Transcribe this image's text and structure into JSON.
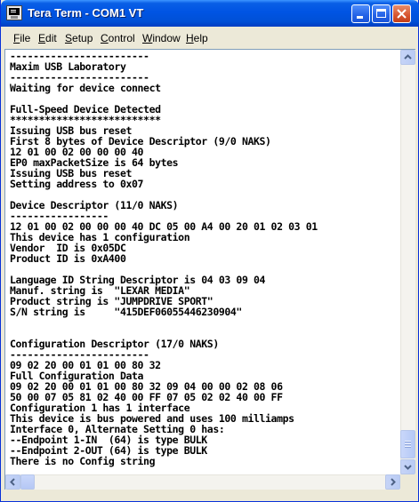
{
  "window": {
    "title": "Tera Term - COM1 VT"
  },
  "menu": [
    {
      "key": "F",
      "rest": "ile"
    },
    {
      "key": "E",
      "rest": "dit"
    },
    {
      "key": "S",
      "rest": "etup"
    },
    {
      "key": "C",
      "rest": "ontrol"
    },
    {
      "key": "W",
      "rest": "indow"
    },
    {
      "key": "H",
      "rest": "elp"
    }
  ],
  "terminal": {
    "lines": [
      "------------------------",
      "Maxim USB Laboratory",
      "------------------------",
      "Waiting for device connect",
      "",
      "Full-Speed Device Detected",
      "**************************",
      "Issuing USB bus reset",
      "First 8 bytes of Device Descriptor (9/0 NAKS)",
      "12 01 00 02 00 00 00 40",
      "EP0 maxPacketSize is 64 bytes",
      "Issuing USB bus reset",
      "Setting address to 0x07",
      "",
      "Device Descriptor (11/0 NAKS)",
      "-----------------",
      "12 01 00 02 00 00 00 40 DC 05 00 A4 00 20 01 02 03 01",
      "This device has 1 configuration",
      "Vendor  ID is 0x05DC",
      "Product ID is 0xA400",
      "",
      "Language ID String Descriptor is 04 03 09 04",
      "Manuf. string is  \"LEXAR MEDIA\"",
      "Product string is \"JUMPDRIVE SPORT\"",
      "S/N string is     \"415DEF06055446230904\"",
      "",
      "",
      "Configuration Descriptor (17/0 NAKS)",
      "------------------------",
      "09 02 20 00 01 01 00 80 32",
      "Full Configuration Data",
      "09 02 20 00 01 01 00 80 32 09 04 00 00 02 08 06",
      "50 00 07 05 81 02 40 00 FF 07 05 02 02 40 00 FF",
      "Configuration 1 has 1 interface",
      "This device is bus powered and uses 100 milliamps",
      "Interface 0, Alternate Setting 0 has:",
      "--Endpoint 1-IN  (64) is type BULK",
      "--Endpoint 2-OUT (64) is type BULK",
      "There is no Config string"
    ]
  }
}
